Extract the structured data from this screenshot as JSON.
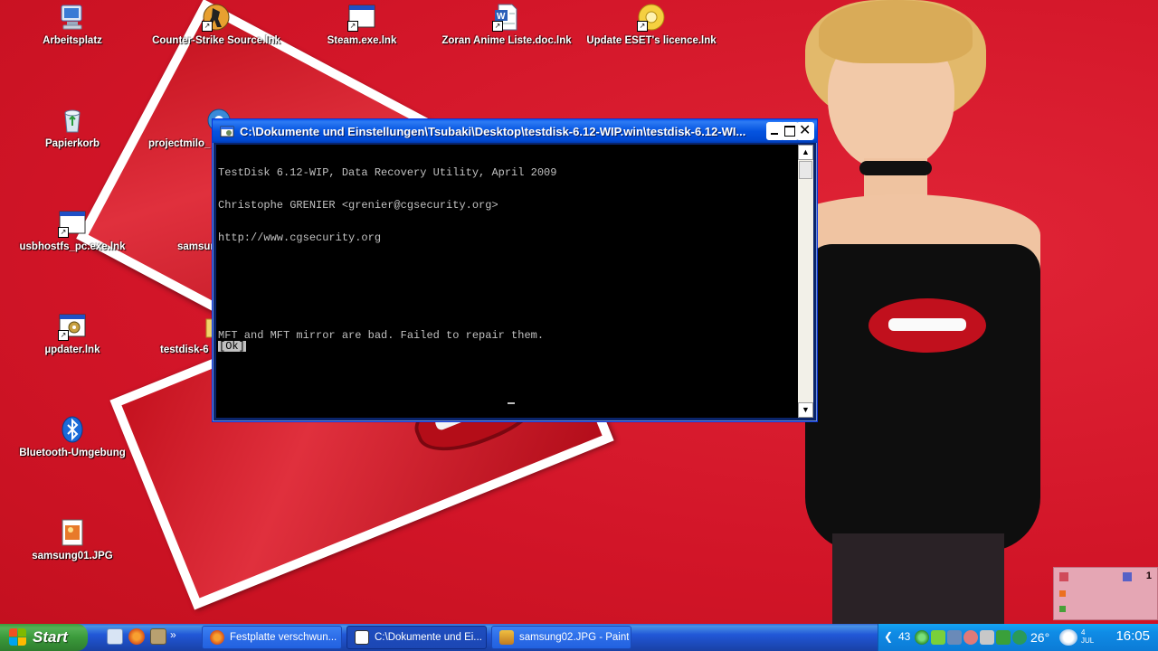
{
  "desktop": {
    "icons": [
      {
        "label": "Arbeitsplatz",
        "icon": "my-computer-icon"
      },
      {
        "label": "Counter-Strike Source.lnk",
        "icon": "cs-source-icon"
      },
      {
        "label": "Steam.exe.lnk",
        "icon": "app-window-icon"
      },
      {
        "label": "Zoran Anime Liste.doc.lnk",
        "icon": "word-doc-icon"
      },
      {
        "label": "Update ESET's licence.lnk",
        "icon": "eset-key-icon"
      },
      {
        "label": "Papierkorb",
        "icon": "recycle-bin-icon"
      },
      {
        "label": "projectmilo_",
        "icon": "app-icon"
      },
      {
        "label": "usbhostfs_pc.exe.lnk",
        "icon": "app-window-icon"
      },
      {
        "label": "samsun",
        "icon": "image-icon"
      },
      {
        "label": "µpdater.lnk",
        "icon": "app-window-gear-icon"
      },
      {
        "label": "testdisk-6",
        "icon": "folder-icon"
      },
      {
        "label": "Bluetooth-Umgebung",
        "icon": "bluetooth-icon"
      },
      {
        "label": "samsung01.JPG",
        "icon": "image-icon"
      }
    ]
  },
  "console_window": {
    "title": "C:\\Dokumente und Einstellungen\\Tsubaki\\Desktop\\testdisk-6.12-WIP.win\\testdisk-6.12-WI...",
    "lines": [
      "TestDisk 6.12-WIP, Data Recovery Utility, April 2009",
      "Christophe GRENIER <grenier@cgsecurity.org>",
      "http://www.cgsecurity.org",
      "",
      "",
      "MFT and MFT mirror are bad. Failed to repair them."
    ],
    "ok_button": "[Ok]"
  },
  "tray_popup": {
    "count": "1"
  },
  "taskbar": {
    "start_label": "Start",
    "quicklaunch_more": "»",
    "buttons": [
      {
        "label": "Festplatte verschwun...",
        "icon": "firefox-icon",
        "active": false
      },
      {
        "label": "C:\\Dokumente und Ei...",
        "icon": "console-icon",
        "active": true
      },
      {
        "label": "samsung02.JPG - Paint",
        "icon": "paint-icon",
        "active": false
      }
    ],
    "tray": {
      "volume_text": "43",
      "temp_text": "26°",
      "date_text": "4 JUL",
      "clock": "16:05"
    }
  },
  "colors": {
    "desktop_bg": "#d8192c",
    "titlebar": "#0554e0",
    "taskbar": "#2157d7",
    "start_green": "#3b9a3b",
    "console_text": "#c0c0c0"
  }
}
